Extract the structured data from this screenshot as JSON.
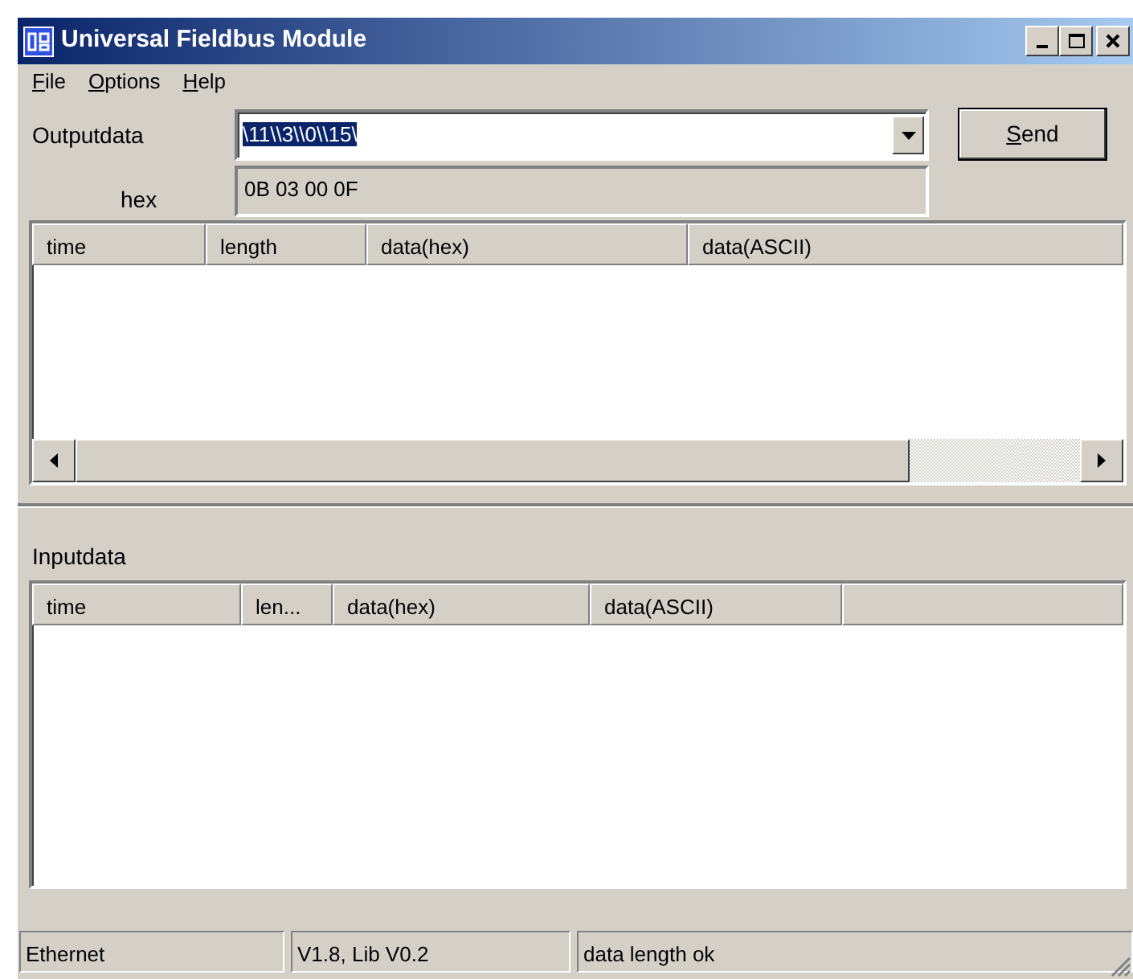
{
  "window": {
    "title": "Universal Fieldbus Module"
  },
  "menu": [
    {
      "label": "File",
      "first_letter_underlined": true
    },
    {
      "label": "Options",
      "first_letter_underlined": true
    },
    {
      "label": "Help",
      "first_letter_underlined": true
    }
  ],
  "output": {
    "label": "Outputdata",
    "value": "\\11\\\\3\\\\0\\\\15\\",
    "value_selected": true,
    "hex_label": "hex",
    "hex_value": "0B 03 00 0F",
    "send": {
      "label": "Send",
      "first_letter_underlined": true
    },
    "columns": [
      "time",
      "length",
      "data(hex)",
      "data(ASCII)"
    ]
  },
  "input": {
    "label": "Inputdata",
    "columns": [
      "time",
      "len...",
      "data(hex)",
      "data(ASCII)"
    ]
  },
  "status_bar": [
    "Ethernet",
    "V1.8, Lib V0.2",
    "data length ok"
  ]
}
